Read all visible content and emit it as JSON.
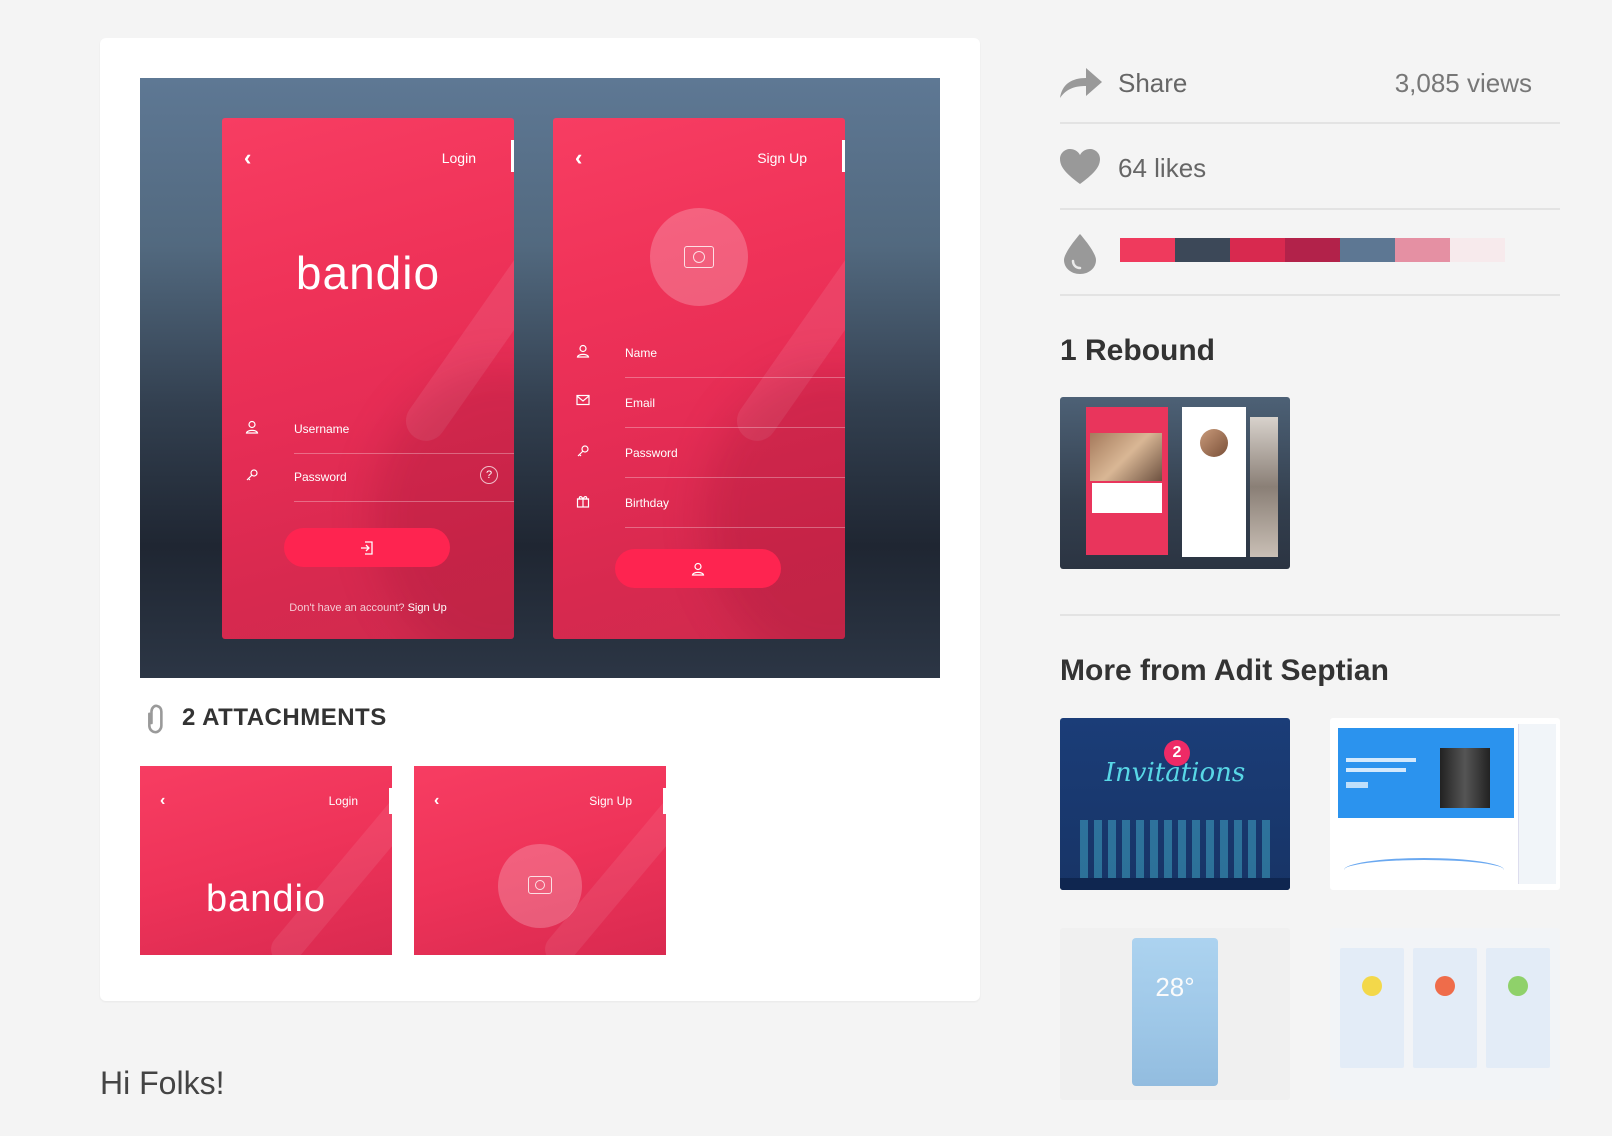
{
  "shot": {
    "login_screen": {
      "back": "‹",
      "title": "Login",
      "brand": "bandio",
      "username_label": "Username",
      "password_label": "Password",
      "help": "?",
      "footer_text": "Don't have an account?",
      "footer_link": "Sign Up"
    },
    "signup_screen": {
      "back": "‹",
      "title": "Sign Up",
      "name_label": "Name",
      "email_label": "Email",
      "password_label": "Password",
      "birthday_label": "Birthday"
    }
  },
  "attachments": {
    "label": "2 ATTACHMENTS",
    "items": [
      {
        "back": "‹",
        "title": "Login",
        "brand": "bandio"
      },
      {
        "back": "‹",
        "title": "Sign Up"
      }
    ]
  },
  "description": {
    "greeting": "Hi Folks!"
  },
  "sidebar": {
    "share_label": "Share",
    "views": "3,085 views",
    "likes": "64 likes",
    "palette": [
      "#ef3a5d",
      "#3c4858",
      "#d8294f",
      "#b2224a",
      "#5d7793",
      "#e590a3",
      "#f7eaec"
    ],
    "rebound_title": "1 Rebound",
    "more_title": "More from Adit Septian",
    "more_items": [
      {
        "badge": "2",
        "text": "Invitations"
      },
      {
        "text": ""
      },
      {
        "temp": "28°"
      },
      {
        "text": ""
      }
    ]
  },
  "colors": {
    "accent": "#f03359",
    "button": "#fe2450",
    "icon_gray": "#999999"
  },
  "icons": {
    "share": "share-arrow-icon",
    "like": "heart-icon",
    "palette": "drop-icon",
    "attachment": "paperclip-icon"
  }
}
